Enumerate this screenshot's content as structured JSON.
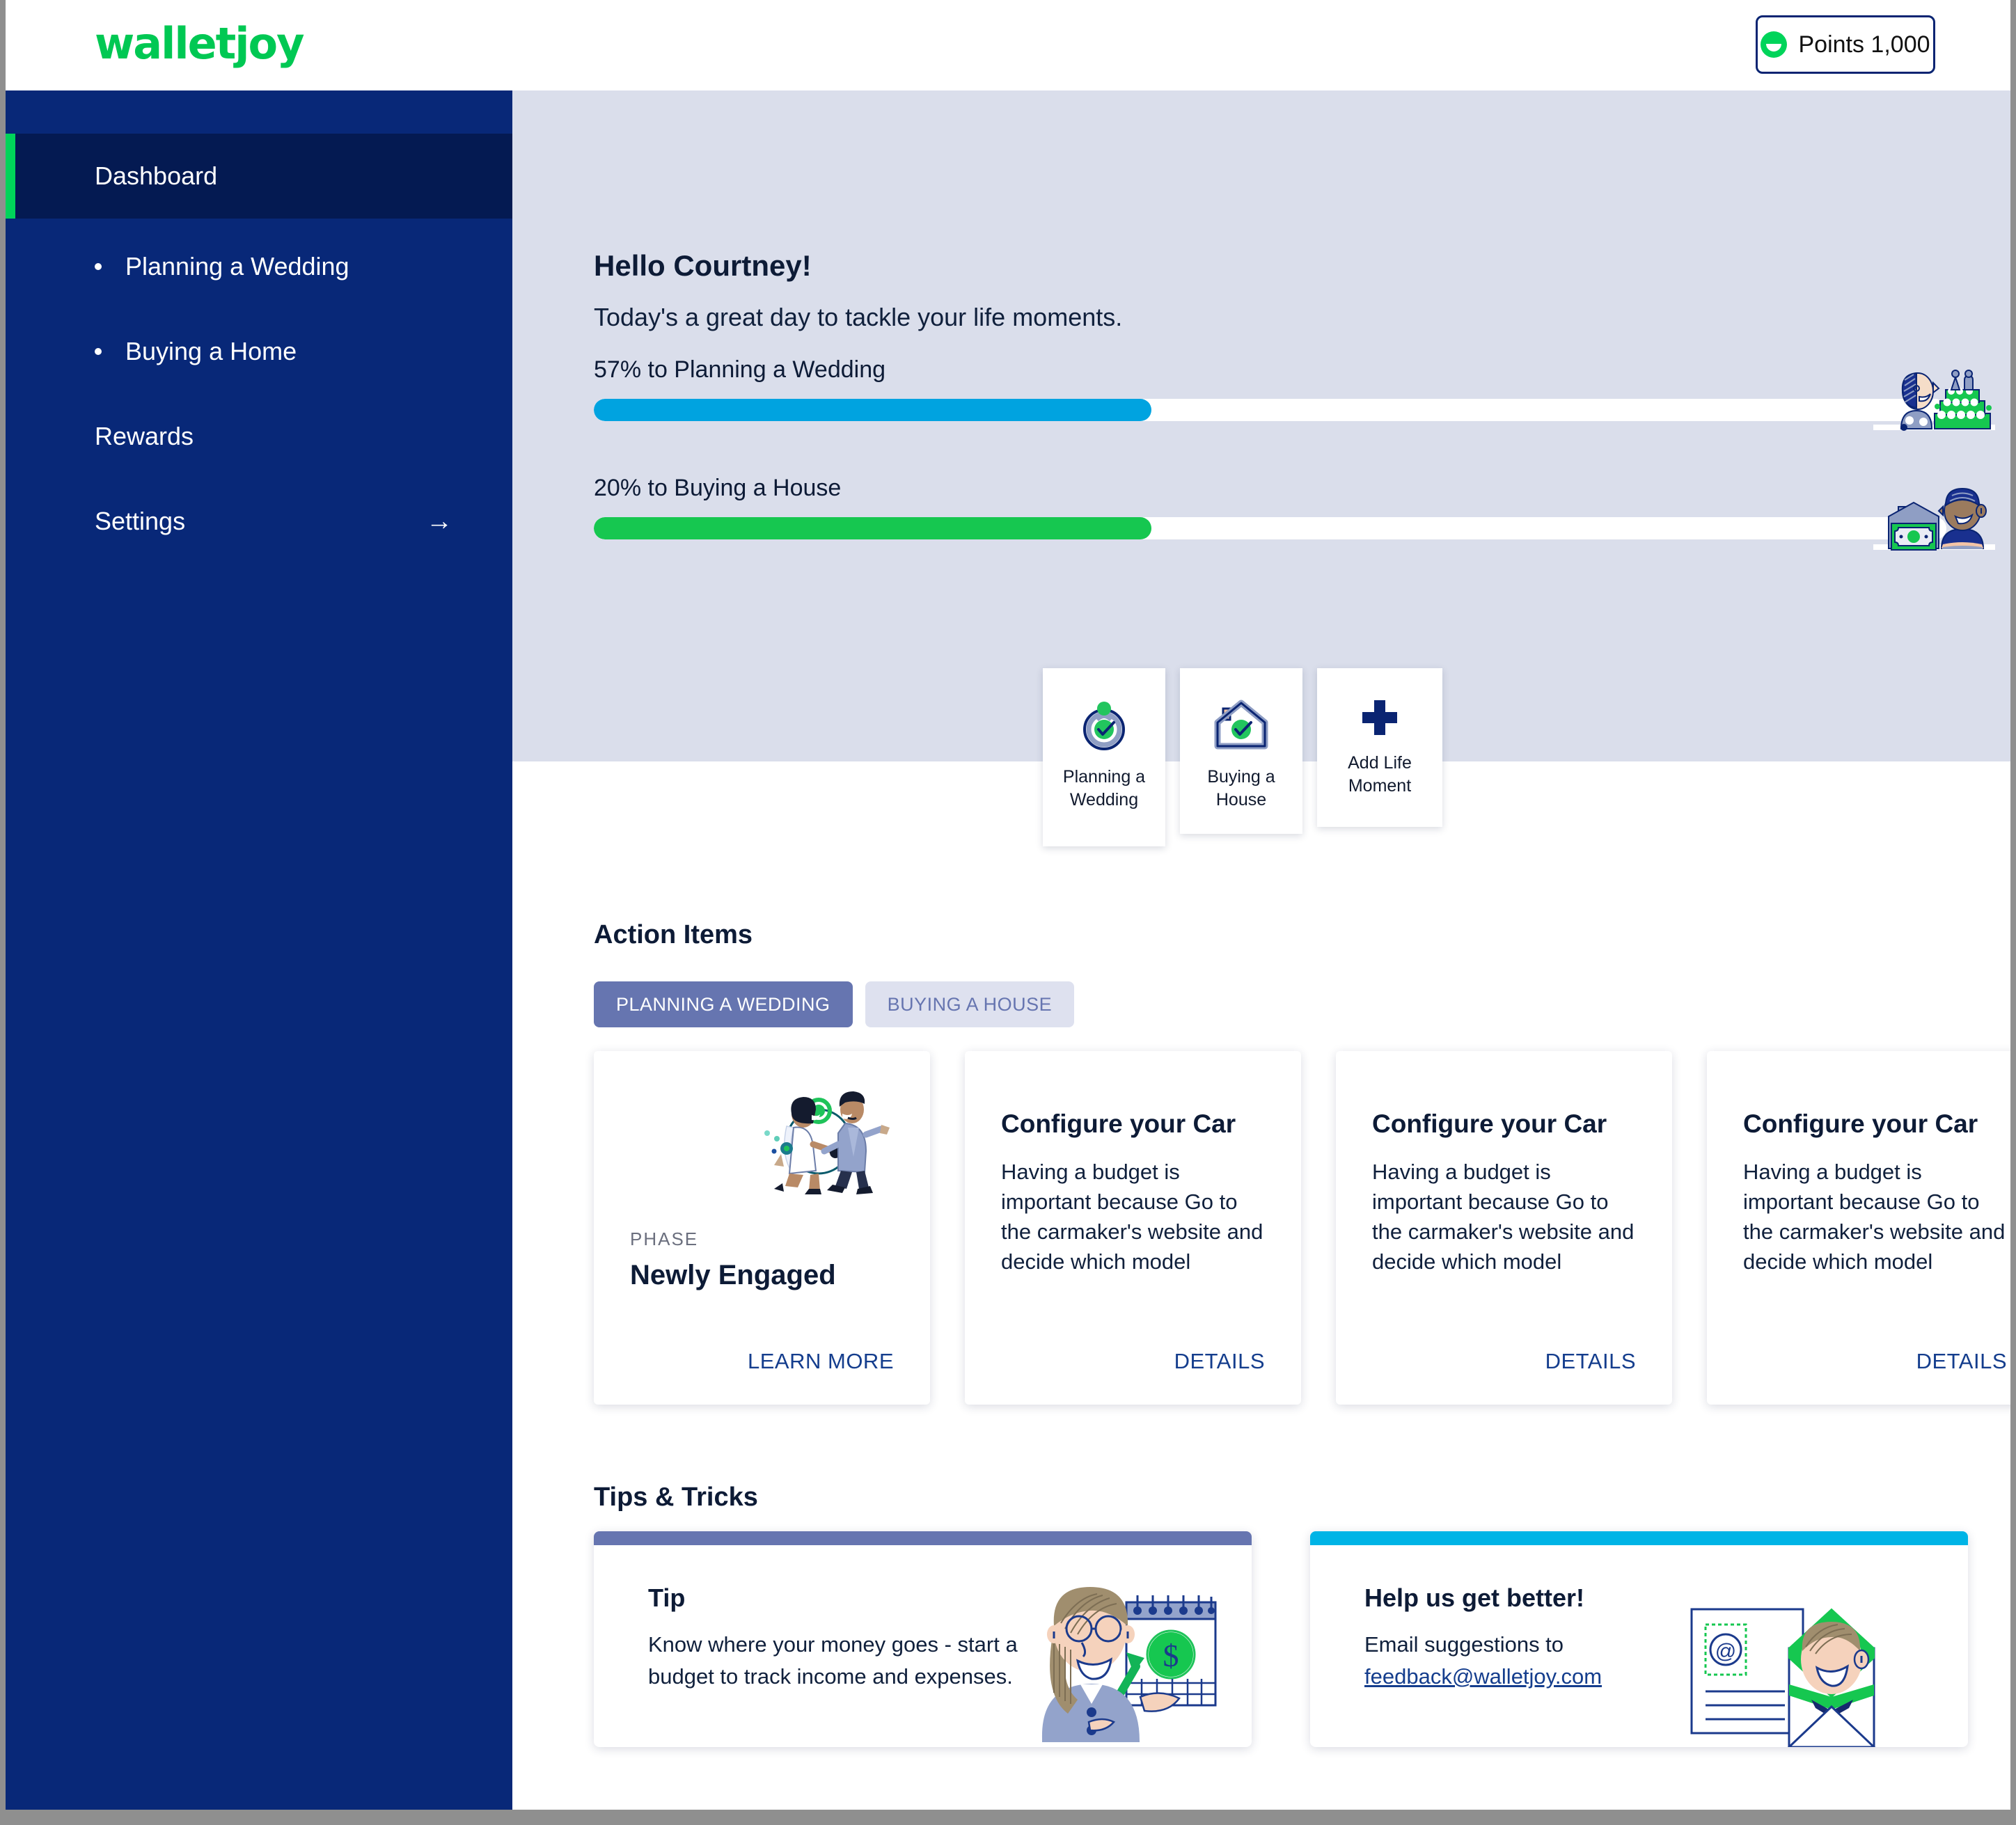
{
  "app": {
    "logo_text": "walletjoy",
    "points_badge": "Points 1,000"
  },
  "sidebar": {
    "items": [
      {
        "label": "Dashboard",
        "type": "top",
        "active": true
      },
      {
        "label": "Planning a Wedding",
        "type": "sub",
        "active": false
      },
      {
        "label": "Buying a Home",
        "type": "sub",
        "active": false
      },
      {
        "label": "Rewards",
        "type": "top",
        "active": false
      },
      {
        "label": "Settings",
        "type": "top",
        "active": false,
        "arrow": "→"
      }
    ]
  },
  "hero": {
    "greeting": "Hello Courtney!",
    "subtitle": "Today's a great day to tackle your life moments.",
    "progress": [
      {
        "label": "57% to Planning a Wedding",
        "percent": 57,
        "fill_ratio": 41,
        "color": "#00a3e0",
        "illustration": "wedding-cake-illustration"
      },
      {
        "label": "20% to Buying a House",
        "percent": 20,
        "fill_ratio": 41,
        "color": "#16c750",
        "illustration": "house-money-illustration"
      }
    ]
  },
  "quick_actions": [
    {
      "label": "Planning a\nWedding",
      "line1": "Planning a",
      "line2": "Wedding",
      "icon": "ring-check-icon"
    },
    {
      "label": "Buying a\nHouse",
      "line1": "Buying a",
      "line2": "House",
      "icon": "house-check-icon"
    },
    {
      "label": "Add Life\nMoment",
      "line1": "Add Life",
      "line2": "Moment",
      "icon": "plus-icon"
    }
  ],
  "action_items": {
    "title": "Action Items",
    "tabs": [
      {
        "label": "PLANNING A WEDDING",
        "active": true
      },
      {
        "label": "BUYING A HOUSE",
        "active": false
      }
    ],
    "phase_card": {
      "kicker": "PHASE",
      "value": "Newly Engaged",
      "link": "LEARN MORE",
      "illustration": "wedding-couple-illustration"
    },
    "cards": [
      {
        "title": "Configure your Car",
        "body": "Having a budget is important because Go to the carmaker's website and decide which model",
        "link": "DETAILS"
      },
      {
        "title": "Configure your Car",
        "body": "Having a budget is important because Go to the carmaker's website and decide which model",
        "link": "DETAILS"
      },
      {
        "title": "Configure your Car",
        "body": "Having a budget is important because Go to the carmaker's website and decide which model",
        "link": "DETAILS"
      }
    ]
  },
  "tips": {
    "title": "Tips & Tricks",
    "cards": [
      {
        "accent": "#6675b0",
        "heading": "Tip",
        "text": "Know where your money goes - start a budget to track income and expenses.",
        "illustration": "woman-budget-chart-illustration"
      },
      {
        "accent": "#00b4e6",
        "heading": "Help us get better!",
        "text": "Email suggestions  to ",
        "link": "feedback@walletjoy.com",
        "illustration": "envelope-person-illustration"
      }
    ]
  },
  "colors": {
    "brand_green": "#00c853",
    "navy": "#082878",
    "navy_dark": "#041a52",
    "hero_bg": "#dadeeb",
    "link": "#143d8d"
  }
}
